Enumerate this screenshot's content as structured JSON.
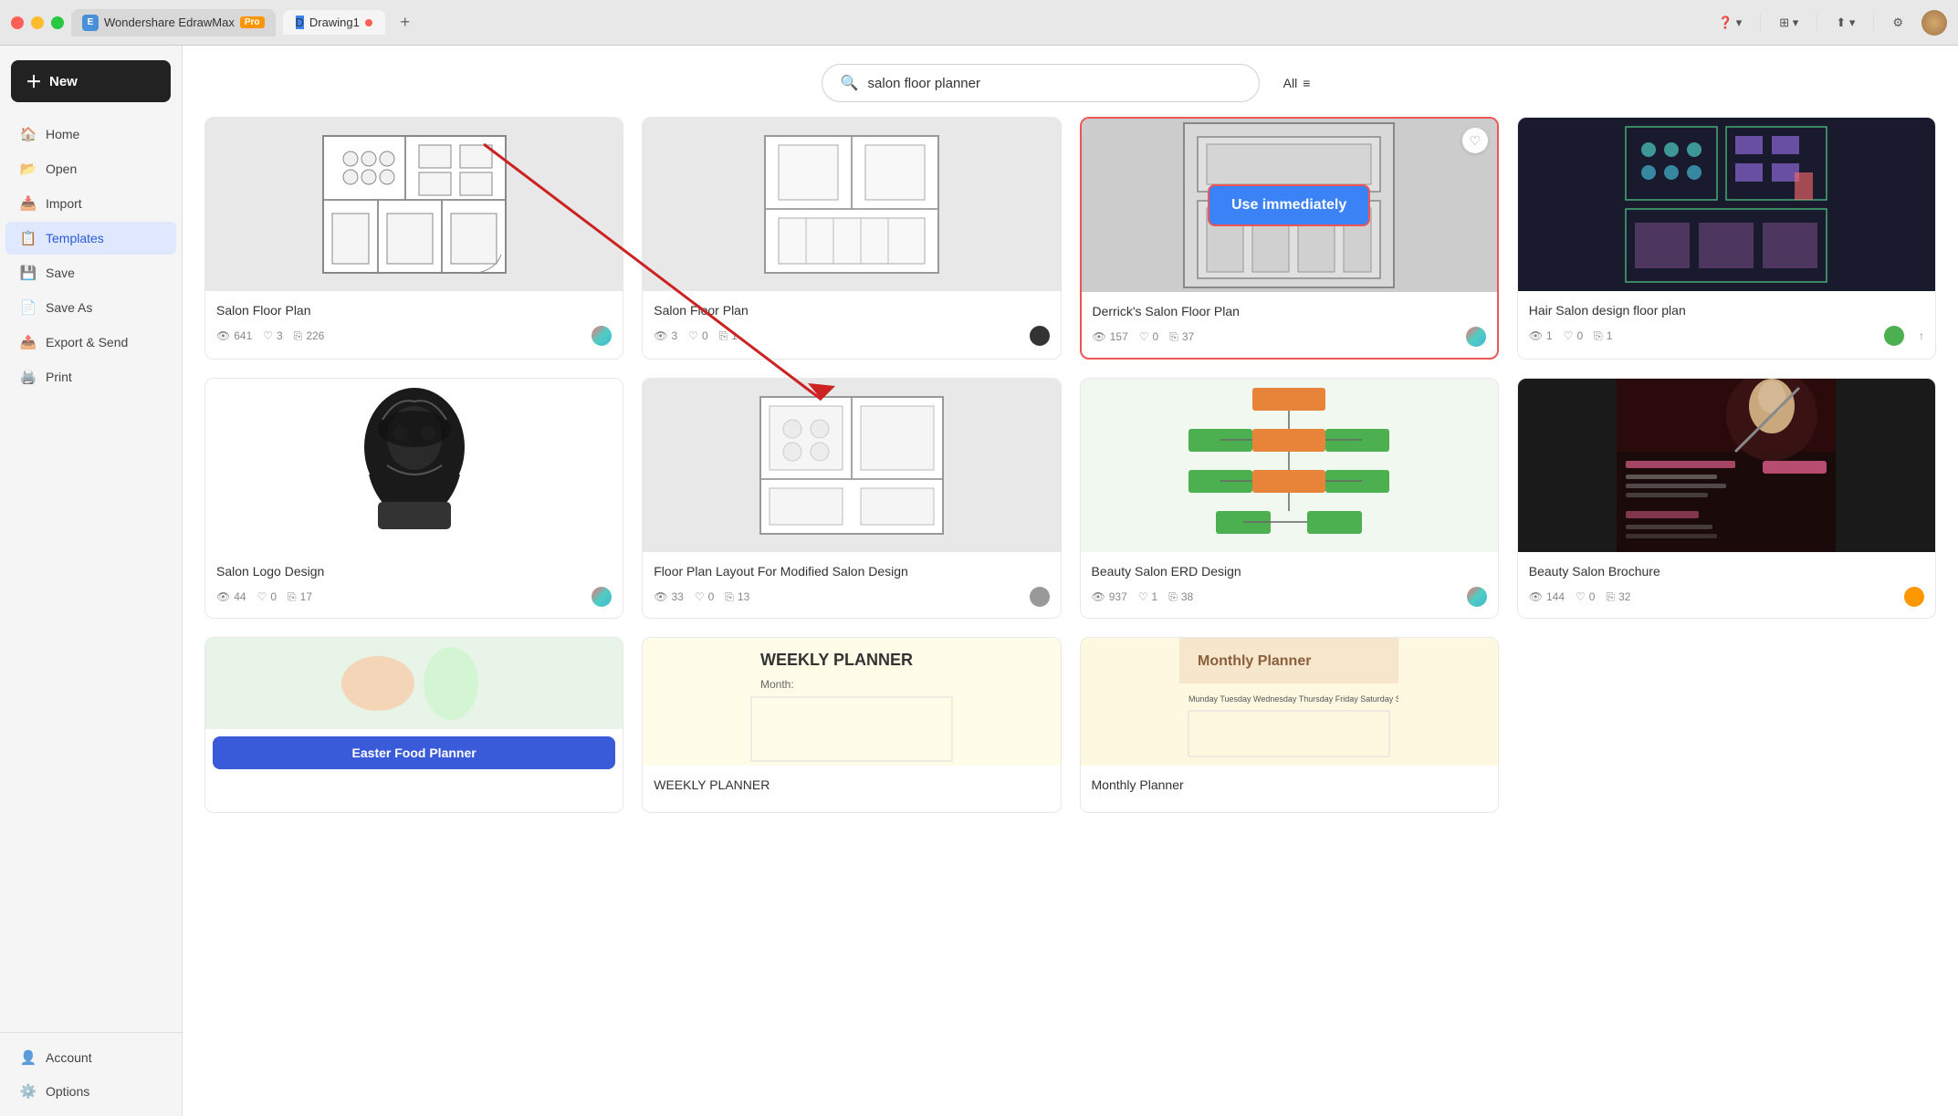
{
  "titlebar": {
    "app_name": "Wondershare EdrawMax",
    "pro_badge": "Pro",
    "drawing_tab": "Drawing1",
    "plus_label": "+"
  },
  "sidebar": {
    "new_label": "+ New",
    "items": [
      {
        "id": "home",
        "label": "Home",
        "icon": "🏠"
      },
      {
        "id": "open",
        "label": "Open",
        "icon": "📂"
      },
      {
        "id": "import",
        "label": "Import",
        "icon": "📥"
      },
      {
        "id": "templates",
        "label": "Templates",
        "icon": "📋"
      },
      {
        "id": "save",
        "label": "Save",
        "icon": "💾"
      },
      {
        "id": "save-as",
        "label": "Save As",
        "icon": "📄"
      },
      {
        "id": "export",
        "label": "Export & Send",
        "icon": "📤"
      },
      {
        "id": "print",
        "label": "Print",
        "icon": "🖨️"
      }
    ],
    "bottom_items": [
      {
        "id": "account",
        "label": "Account",
        "icon": "👤"
      },
      {
        "id": "options",
        "label": "Options",
        "icon": "⚙️"
      }
    ]
  },
  "search": {
    "placeholder": "salon floor planner",
    "value": "salon floor planner",
    "filter_label": "All"
  },
  "templates": [
    {
      "id": 1,
      "title": "Salon Floor Plan",
      "views": "641",
      "likes": "3",
      "copies": "226",
      "author_color": "multi"
    },
    {
      "id": 2,
      "title": "Salon Floor Plan",
      "views": "3",
      "likes": "0",
      "copies": "1",
      "author_color": "dark"
    },
    {
      "id": 3,
      "title": "Derrick's Salon Floor Plan",
      "views": "157",
      "likes": "0",
      "copies": "37",
      "author_color": "multi",
      "highlighted": true,
      "use_btn": "Use immediately"
    },
    {
      "id": 4,
      "title": "Hair Salon design floor plan",
      "views": "1",
      "likes": "0",
      "copies": "1",
      "author_color": "green"
    },
    {
      "id": 5,
      "title": "Salon Logo Design",
      "views": "44",
      "likes": "0",
      "copies": "17",
      "author_color": "multi"
    },
    {
      "id": 6,
      "title": "Floor Plan Layout For Modified Salon Design",
      "views": "33",
      "likes": "0",
      "copies": "13",
      "author_color": "gray"
    },
    {
      "id": 7,
      "title": "Beauty Salon ERD Design",
      "views": "937",
      "likes": "1",
      "copies": "38",
      "author_color": "multi"
    },
    {
      "id": 8,
      "title": "Beauty Salon Brochure",
      "views": "144",
      "likes": "0",
      "copies": "32",
      "author_color": "orange"
    },
    {
      "id": 9,
      "title": "Easter Food Planner",
      "button_label": "Easter Food Planner"
    },
    {
      "id": 10,
      "title": "WEEKLY PLANNER",
      "subtitle": "Month:"
    },
    {
      "id": 11,
      "title": "Monthly Planner",
      "days": "Munday  Tuesday  Wednesday  Thursday  Friday  Saturday  Sunday"
    }
  ],
  "use_immediately": "Use immediately"
}
